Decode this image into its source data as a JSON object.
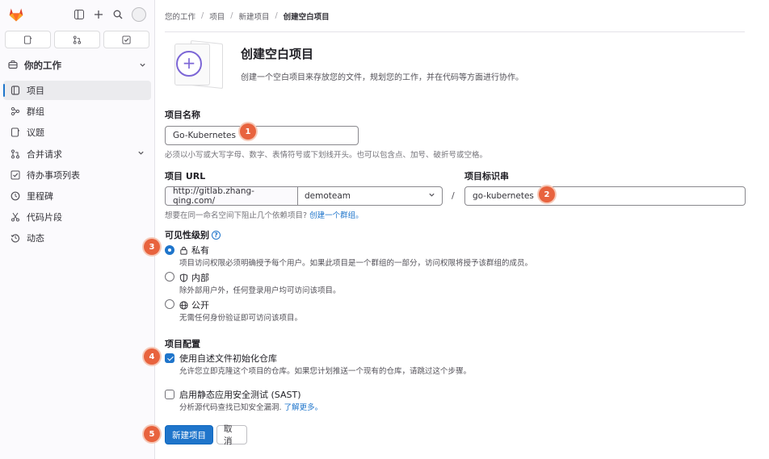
{
  "sidebar": {
    "section_title": "你的工作",
    "items": [
      {
        "label": "项目",
        "icon": "project-icon"
      },
      {
        "label": "群组",
        "icon": "group-icon"
      },
      {
        "label": "议题",
        "icon": "issues-icon"
      },
      {
        "label": "合并请求",
        "icon": "merge-request-icon"
      },
      {
        "label": "待办事项列表",
        "icon": "todo-icon"
      },
      {
        "label": "里程碑",
        "icon": "milestone-icon"
      },
      {
        "label": "代码片段",
        "icon": "snippet-icon"
      },
      {
        "label": "动态",
        "icon": "activity-icon"
      }
    ]
  },
  "breadcrumb": [
    "您的工作",
    "项目",
    "新建项目",
    "创建空白项目"
  ],
  "header": {
    "title": "创建空白项目",
    "description": "创建一个空白项目来存放您的文件，规划您的工作，并在代码等方面进行协作。"
  },
  "form": {
    "project_name_label": "项目名称",
    "project_name_value": "Go-Kubernetes",
    "project_name_help": "必须以小写或大写字母、数字、表情符号或下划线开头。也可以包含点、加号、破折号或空格。",
    "project_url_label": "项目 URL",
    "url_prefix": "http://gitlab.zhang-qing.com/",
    "namespace": "demoteam",
    "slash": "/",
    "slug_label": "项目标识串",
    "slug_value": "go-kubernetes",
    "group_help_text": "想要在同一命名空间下阻止几个依赖项目?",
    "group_help_link": "创建一个群组。",
    "visibility_label": "可见性级别",
    "visibility_help_icon": "?",
    "visibility_options": [
      {
        "title": "私有",
        "icon": "lock-icon",
        "desc": "项目访问权限必须明确授予每个用户。如果此项目是一个群组的一部分，访问权限将授予该群组的成员。",
        "checked": true
      },
      {
        "title": "内部",
        "icon": "shield-icon",
        "desc": "除外部用户外，任何登录用户均可访问该项目。",
        "checked": false
      },
      {
        "title": "公开",
        "icon": "globe-icon",
        "desc": "无需任何身份验证即可访问该项目。",
        "checked": false
      }
    ],
    "config_label": "项目配置",
    "config_options": [
      {
        "title": "使用自述文件初始化仓库",
        "desc": "允许您立即克隆这个项目的仓库。如果您计划推送一个现有的仓库，请跳过这个步骤。",
        "checked": true
      },
      {
        "title": "启用静态应用安全测试 (SAST)",
        "desc": "分析源代码查找已知安全漏洞.",
        "link": "了解更多。",
        "checked": false
      }
    ],
    "create_button": "新建项目",
    "cancel_button": "取消"
  },
  "badges": [
    "1",
    "2",
    "3",
    "4",
    "5"
  ],
  "colors": {
    "primary": "#1f75cb",
    "badge": "#e8633e",
    "accent": "#7c66d6"
  }
}
